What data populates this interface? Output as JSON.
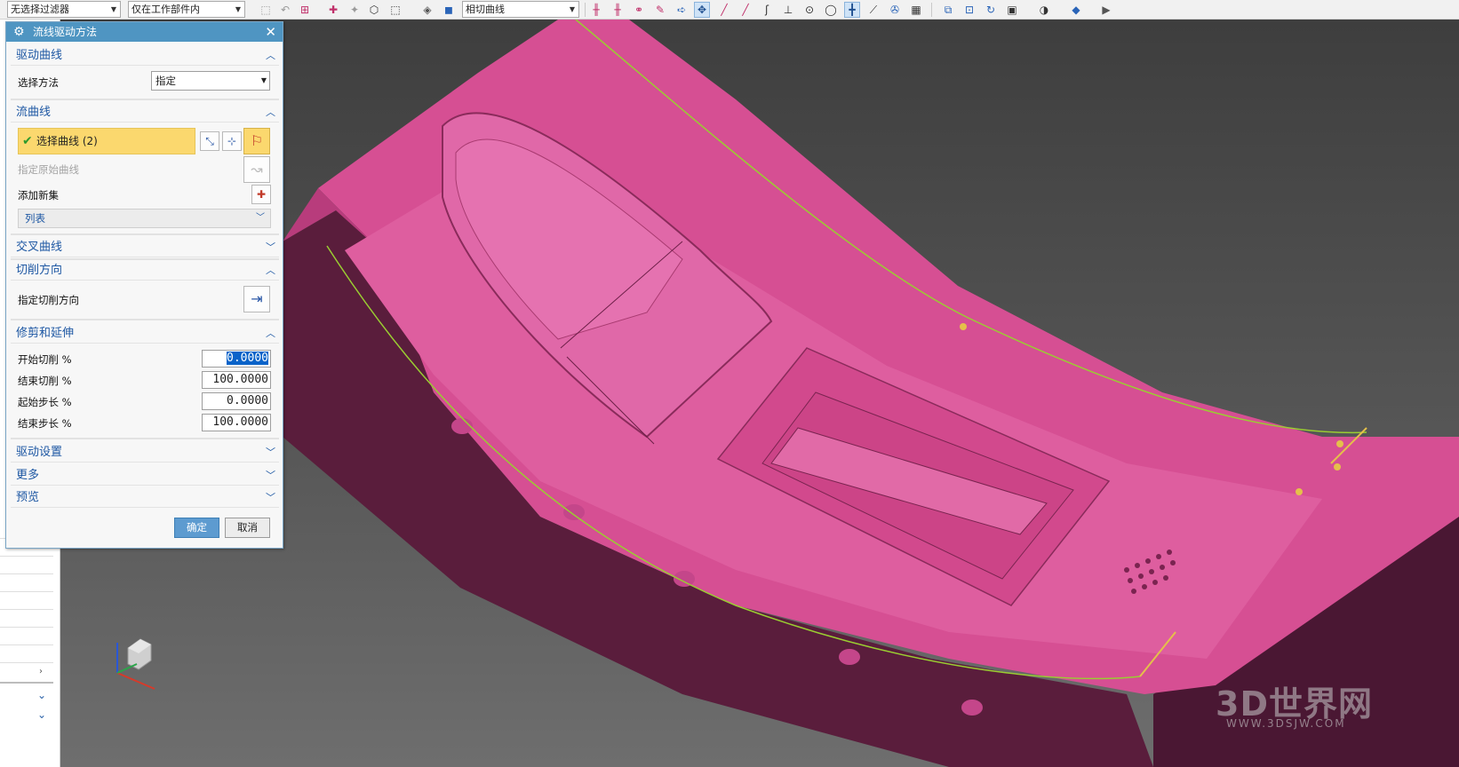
{
  "toolbar": {
    "filter_combo": "无选择过滤器",
    "scope_combo": "仅在工作部件内",
    "curve_rule_combo": "相切曲线"
  },
  "dialog": {
    "title": "流线驱动方法",
    "sections": {
      "drive_curve": "驱动曲线",
      "flow_curve": "流曲线",
      "cross_curve": "交叉曲线",
      "cut_direction": "切削方向",
      "trim_extend": "修剪和延伸",
      "drive_settings": "驱动设置",
      "more": "更多",
      "preview": "预览"
    },
    "select_method_label": "选择方法",
    "select_method_value": "指定",
    "select_curve_label": "选择曲线 (2)",
    "specify_original_curve": "指定原始曲线",
    "add_new_set": "添加新集",
    "list_label": "列表",
    "specify_cut_direction": "指定切削方向",
    "fields": [
      {
        "label": "开始切削 %",
        "value": "0.0000"
      },
      {
        "label": "结束切削 %",
        "value": "100.0000"
      },
      {
        "label": "起始步长 %",
        "value": "0.0000"
      },
      {
        "label": "结束步长 %",
        "value": "100.0000"
      }
    ],
    "ok": "确定",
    "cancel": "取消"
  },
  "watermark": {
    "text": "3D世界网",
    "url": "WWW.3DSJW.COM"
  },
  "colors": {
    "part": "#d64f93",
    "part_side": "#5a1d3c",
    "dialog_title": "#4f95c2",
    "section_header": "#1d57a3",
    "highlight": "#fbd86e"
  }
}
